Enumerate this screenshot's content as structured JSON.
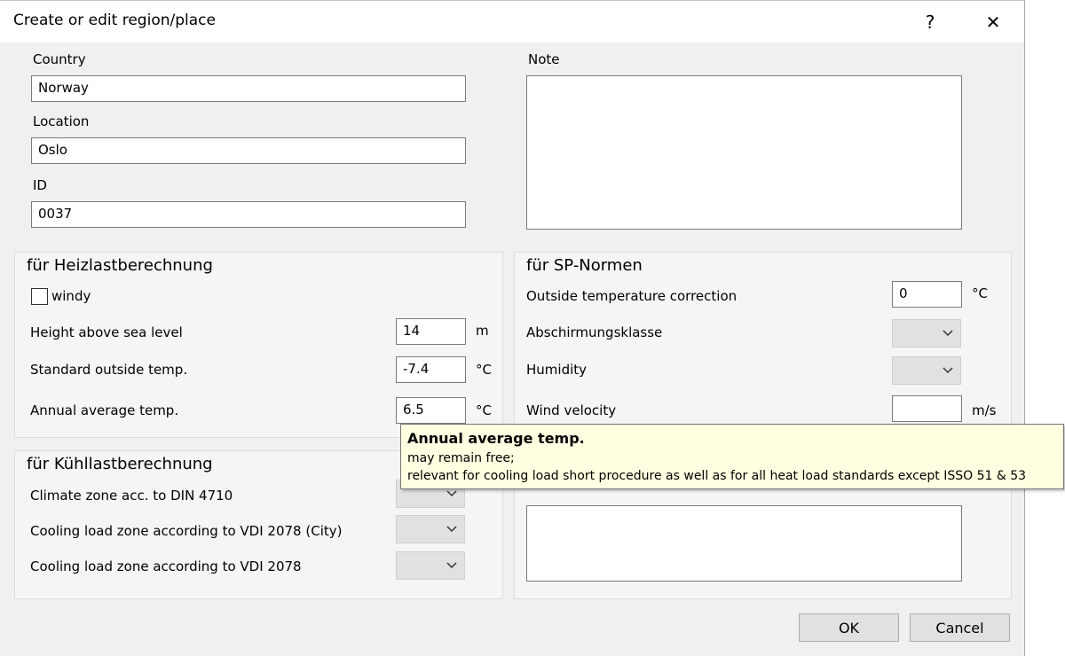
{
  "window": {
    "title": "Create or edit region/place",
    "help_glyph": "?",
    "close_glyph": "✕"
  },
  "fields": {
    "country_label": "Country",
    "country_value": "Norway",
    "location_label": "Location",
    "location_value": "Oslo",
    "id_label": "ID",
    "id_value": "0037",
    "note_label": "Note",
    "note_value": ""
  },
  "heat_group": {
    "title": "für Heizlastberechnung",
    "windy_label": "windy",
    "windy_checked": false,
    "height_label": "Height above sea level",
    "height_value": "14",
    "height_unit": "m",
    "std_temp_label": "Standard outside temp.",
    "std_temp_value": "-7.4",
    "std_temp_unit": "°C",
    "annual_label": "Annual average temp.",
    "annual_value": "6.5",
    "annual_unit": "°C"
  },
  "sp_group": {
    "title": "für SP-Normen",
    "temp_corr_label": "Outside temperature correction",
    "temp_corr_value": "0",
    "temp_corr_unit": "°C",
    "shield_label": "Abschirmungsklasse",
    "shield_value": "",
    "humidity_label": "Humidity",
    "humidity_value": "",
    "wind_label": "Wind velocity",
    "wind_value": "",
    "wind_unit": "m/s"
  },
  "cool_group": {
    "title": "für Kühllastberechnung",
    "climate_label": "Climate zone acc. to DIN 4710",
    "city_label": "Cooling load zone according to VDI 2078 (City)",
    "vdi_label": "Cooling load zone according to VDI 2078"
  },
  "tooltip": {
    "title": "Annual average temp.",
    "line1": "may remain free;",
    "line2": "relevant for cooling load short procedure as well as for all heat load standards except ISSO 51 & 53"
  },
  "buttons": {
    "ok": "OK",
    "cancel": "Cancel"
  },
  "icons": {
    "dropdown": "chevron-down-icon"
  },
  "colors": {
    "dialog_bg": "#f0f0f0",
    "tooltip_bg": "#ffffe1"
  }
}
